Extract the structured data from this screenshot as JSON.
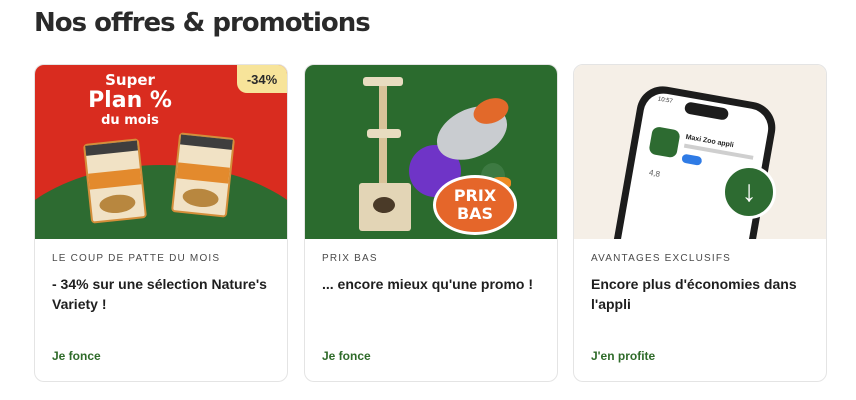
{
  "page": {
    "title": "Nos offres & promotions"
  },
  "offers": [
    {
      "kicker": "LE COUP DE PATTE DU MOIS",
      "headline": "- 34% sur une sélection Nature's Variety !",
      "link": "Je fonce",
      "image": {
        "badge": "-34%",
        "promo_line1": "Super",
        "promo_line2": "Plan %",
        "promo_line3": "du mois"
      }
    },
    {
      "kicker": "PRIX BAS",
      "headline": "... encore mieux qu'une promo !",
      "link": "Je fonce",
      "image": {
        "badge_line1": "PRIX",
        "badge_line2": "BAS"
      }
    },
    {
      "kicker": "AVANTAGES EXCLUSIFS",
      "headline": "Encore plus d'économies dans l'appli",
      "link": "J'en profite",
      "image": {
        "phone_time": "10:57",
        "app_name": "Maxi Zoo appli",
        "rating": "4,8"
      }
    }
  ],
  "colors": {
    "brand_green": "#2d6b31",
    "link_green": "#2f6b2a",
    "promo_red": "#d92c1f",
    "badge_yellow": "#f7e49a",
    "prix_orange": "#e5662a"
  }
}
